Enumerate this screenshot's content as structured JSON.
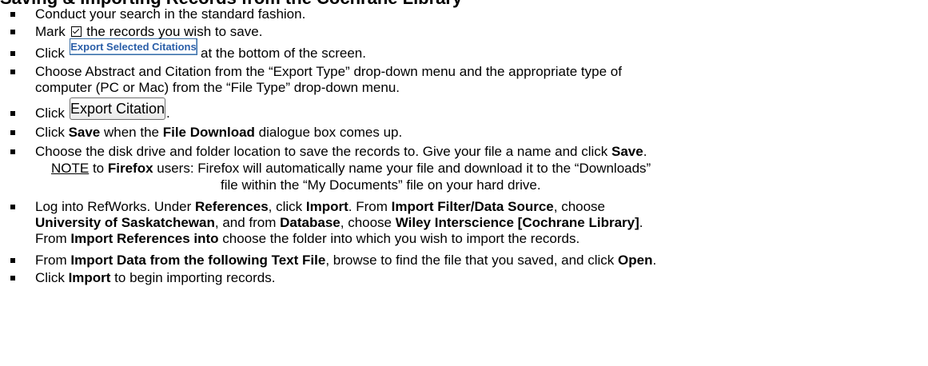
{
  "heading": "Saving & Importing Records from the Cochrane Library",
  "steps": {
    "s1": "Conduct your search in the standard fashion.",
    "s2": {
      "before": "Mark",
      "after": "the records you wish to save."
    },
    "s3": {
      "click": "Click",
      "button": "Export Selected Citations",
      "after": "at the bottom of the screen."
    },
    "s4": {
      "line1": "Choose Abstract and Citation from the “Export Type” drop-down menu and the appropriate type of",
      "line2": "computer (PC or Mac) from the “File Type” drop-down menu."
    },
    "s5": {
      "click": "Click",
      "button": "Export Citation",
      "after": "."
    },
    "s6": {
      "t1": "Click ",
      "b1": "Save",
      "t2": " when the ",
      "b2": "File Download",
      "t3": " dialogue box comes up."
    },
    "s7": {
      "t1": "Choose the disk drive and folder location to save the records to.  Give your file a name and click ",
      "b1": "Save",
      "t2": ".",
      "note": "NOTE",
      "note_to": " to ",
      "firefox": "Firefox",
      "note_t1": " users:  Firefox will automatically name your file and download it to the “Downloads”",
      "note_t2": "file within the “My Documents” file on your hard drive."
    },
    "s8": {
      "t1": "Log into RefWorks.   Under ",
      "b1": "References",
      "t2": ", click ",
      "b2": "Import",
      "t3": ".  From ",
      "b3": "Import Filter/Data Source",
      "t4": ", choose",
      "b4": "University of Saskatchewan",
      "t5": ", and from ",
      "b5": "Database",
      "t6": ", choose ",
      "b6": "Wiley Interscience [Cochrane Library]",
      "t7": ".",
      "t8": "From ",
      "b7": "Import References into",
      "t9": " choose the folder into which you wish to import the records."
    },
    "s9": {
      "t1": "From ",
      "b1": "Import Data from the following Text File",
      "t2": ", browse to find the file that you saved, and click ",
      "b2": "Open",
      "t3": "."
    },
    "s10": {
      "t1": "Click ",
      "b1": "Import",
      "t2": " to begin importing records."
    }
  }
}
